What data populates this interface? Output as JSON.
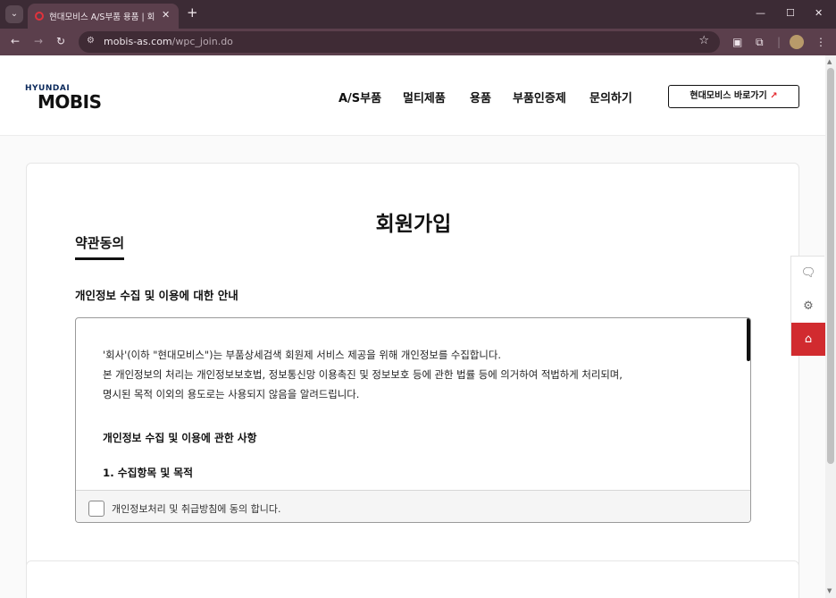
{
  "browser": {
    "tab_title": "현대모비스 A/S부품 용품 | 회원",
    "tab_close": "✕",
    "new_tab": "+",
    "tab_menu": "⌄",
    "url_host": "mobis-as.com",
    "url_path": "/wpc_join.do",
    "controls": {
      "minimize": "—",
      "maximize": "☐",
      "close": "✕"
    },
    "nav": {
      "back": "←",
      "forward": "→",
      "reload": "↻"
    }
  },
  "header": {
    "logo_top": "HYUNDAI",
    "logo_main": "MOBIS",
    "nav": [
      "A/S부품",
      "멀티제품",
      "용품",
      "부품인증제",
      "문의하기"
    ],
    "go_button": "현대모비스 바로가기",
    "go_arrow": "↗"
  },
  "main": {
    "title": "회원가입",
    "section_tab": "약관동의",
    "subhead": "개인정보 수집 및 이용에 대한 안내",
    "terms": {
      "lines": [
        "'회사'(이하 \"현대모비스\")는 부품상세검색 회원제 서비스 제공을 위해 개인정보를 수집합니다.",
        "본 개인정보의 처리는 개인정보보호법, 정보통신망 이용촉진 및 정보보호 등에 관한 법률 등에 의거하여 적법하게 처리되며,",
        "명시된 목적 이외의 용도로는 사용되지 않음을 알려드립니다."
      ],
      "heading1": "개인정보 수집 및 이용에 관한 사항",
      "heading2": "1. 수집항목 및 목적"
    },
    "agree_label": "개인정보처리 및 취급방침에 동의 합니다."
  },
  "quick_menu": {
    "chat": "🗨",
    "settings": "⚙",
    "home": "⌂"
  }
}
